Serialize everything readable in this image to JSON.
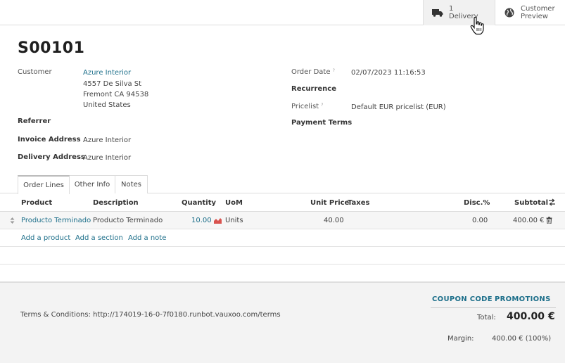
{
  "smart_buttons": {
    "delivery_count": "1",
    "delivery_label": "Delivery",
    "preview_line1": "Customer",
    "preview_line2": "Preview"
  },
  "order": {
    "name": "S00101",
    "customer_label": "Customer",
    "customer_name": "Azure Interior",
    "address_line1": "4557 De Silva St",
    "address_line2": "Fremont CA 94538",
    "address_line3": "United States",
    "referrer_label": "Referrer",
    "invoice_address_label": "Invoice Address",
    "invoice_address": "Azure Interior",
    "delivery_address_label": "Delivery Address",
    "delivery_address": "Azure Interior",
    "order_date_label": "Order Date",
    "order_date_help": "?",
    "order_date": "02/07/2023 11:16:53",
    "recurrence_label": "Recurrence",
    "pricelist_label": "Pricelist",
    "pricelist_help": "?",
    "pricelist": "Default EUR pricelist (EUR)",
    "payment_terms_label": "Payment Terms"
  },
  "tabs": [
    "Order Lines",
    "Other Info",
    "Notes"
  ],
  "columns": {
    "product": "Product",
    "description": "Description",
    "quantity": "Quantity",
    "uom": "UoM",
    "unit_price": "Unit Price",
    "taxes": "Taxes",
    "disc": "Disc.%",
    "subtotal": "Subtotal"
  },
  "line": {
    "product": "Producto Terminado",
    "description": "Producto Terminado",
    "quantity": "10.00",
    "uom": "Units",
    "unit_price": "40.00",
    "taxes": "",
    "disc": "0.00",
    "subtotal": "400.00 €"
  },
  "add_links": {
    "product": "Add a product",
    "section": "Add a section",
    "note": "Add a note"
  },
  "footer": {
    "terms": "Terms & Conditions: http://174019-16-0-7f0180.runbot.vauxoo.com/terms",
    "coupon_code": "COUPON CODE",
    "promotions": "PROMOTIONS",
    "total_label": "Total:",
    "total_value": "400.00 €",
    "margin_label": "Margin:",
    "margin_value": "400.00 € (100%)"
  },
  "icons": [
    "truck-icon",
    "globe-icon",
    "hand-cursor-icon",
    "handle-icon",
    "forecast-chart-icon",
    "trash-icon",
    "column-settings-icon"
  ],
  "colors": {
    "link": "#1d6f8a",
    "forecast": "#d9534f"
  }
}
